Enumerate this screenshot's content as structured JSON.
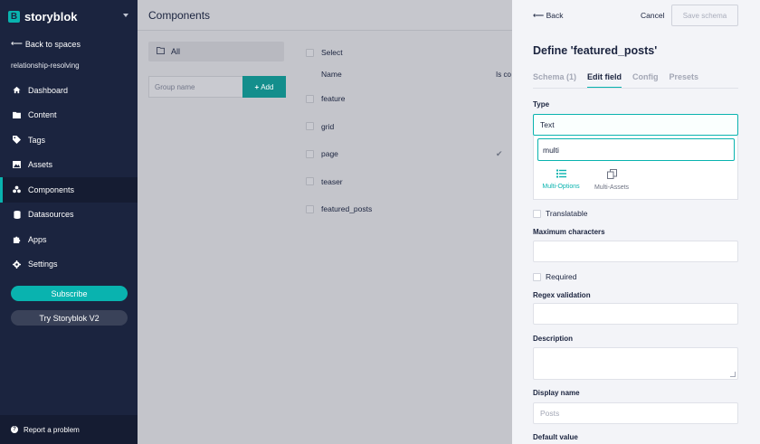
{
  "sidebar": {
    "logo_letter": "B",
    "logo_text": "storyblok",
    "back_label": "Back to spaces",
    "space_name": "relationship-resolving",
    "nav": [
      {
        "label": "Dashboard",
        "icon": "home-icon"
      },
      {
        "label": "Content",
        "icon": "folder-icon"
      },
      {
        "label": "Tags",
        "icon": "tag-icon"
      },
      {
        "label": "Assets",
        "icon": "image-icon"
      },
      {
        "label": "Components",
        "icon": "components-icon",
        "active": true
      },
      {
        "label": "Datasources",
        "icon": "database-icon"
      },
      {
        "label": "Apps",
        "icon": "puzzle-icon"
      },
      {
        "label": "Settings",
        "icon": "gear-icon"
      }
    ],
    "subscribe_label": "Subscribe",
    "try_v2_label": "Try Storyblok V2",
    "report_label": "Report a problem"
  },
  "main": {
    "title": "Components",
    "folder_all_label": "All",
    "group_placeholder": "Group name",
    "add_label": "Add",
    "table": {
      "select_label": "Select",
      "col_name": "Name",
      "col_is_content": "Is co",
      "rows": [
        {
          "name": "feature",
          "is_content": false
        },
        {
          "name": "grid",
          "is_content": false
        },
        {
          "name": "page",
          "is_content": true
        },
        {
          "name": "teaser",
          "is_content": false
        },
        {
          "name": "featured_posts",
          "is_content": false
        }
      ]
    }
  },
  "panel": {
    "back_label": "Back",
    "cancel_label": "Cancel",
    "save_label": "Save schema",
    "title": "Define 'featured_posts'",
    "tabs": [
      {
        "label": "Schema (1)",
        "active": false
      },
      {
        "label": "Edit field",
        "active": true
      },
      {
        "label": "Config",
        "active": false
      },
      {
        "label": "Presets",
        "active": false
      }
    ],
    "type_label": "Type",
    "type_value": "Text",
    "search_value": "multi",
    "options": [
      {
        "label": "Multi-Options",
        "icon": "list-icon",
        "selected": true
      },
      {
        "label": "Multi-Assets",
        "icon": "copy-icon",
        "selected": false
      }
    ],
    "translatable_label": "Translatable",
    "max_chars_label": "Maximum characters",
    "max_chars_value": "",
    "required_label": "Required",
    "regex_label": "Regex validation",
    "regex_value": "",
    "description_label": "Description",
    "display_name_label": "Display name",
    "display_name_placeholder": "Posts",
    "default_value_label": "Default value"
  },
  "colors": {
    "sidebar_bg": "#1b243f",
    "accent": "#09b3af",
    "panel_bg": "#f3f4f8"
  }
}
